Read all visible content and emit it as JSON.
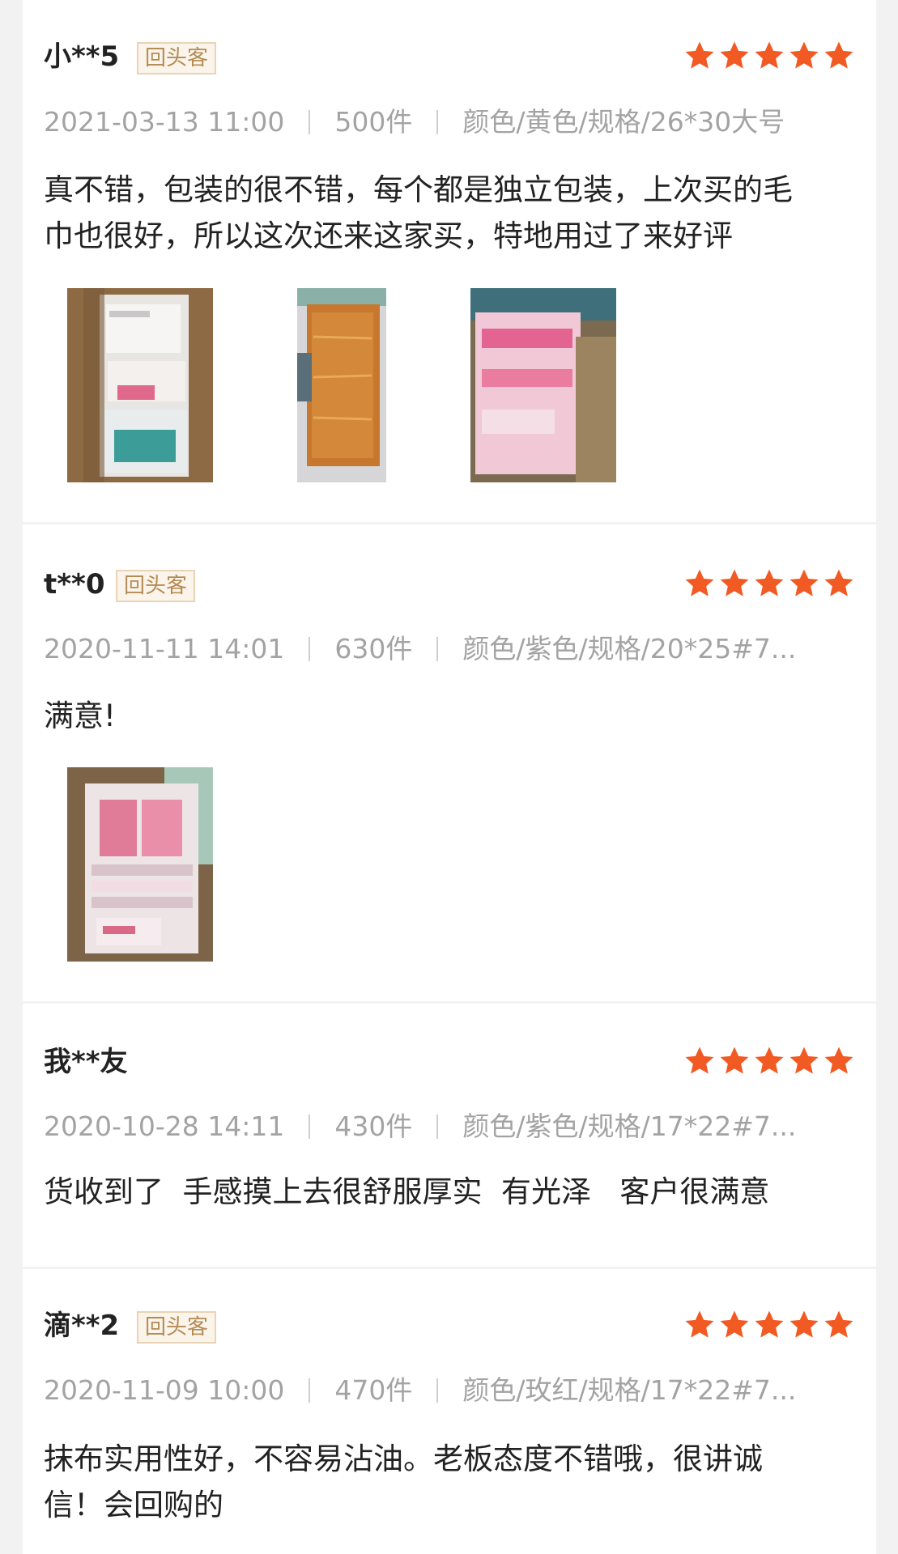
{
  "colors": {
    "page_bg": "#f2f2f2",
    "card_bg": "#ffffff",
    "star": "#f25a24",
    "badge_text": "#b48b54",
    "badge_border": "#e9d4b5",
    "meta_text": "#a3a3a3"
  },
  "reviews": [
    {
      "user": "小**5",
      "badge": "回头客",
      "rating": 5,
      "date": "2021-03-13 11:00",
      "quantity": "500件",
      "spec": "颜色/黄色/规格/26*30大号",
      "content": "真不错，包装的很不错，每个都是独立包装，上次买的毛\n巾也很好，所以这次还来这家买，特地用过了来好评",
      "photos": [
        "photo-box-of-packaged-cloths",
        "photo-gold-scouring-pad",
        "photo-pink-packages-in-box"
      ]
    },
    {
      "user": "t**0",
      "badge": "回头客",
      "rating": 5,
      "date": "2020-11-11 14:01",
      "quantity": "630件",
      "spec": "颜色/紫色/规格/20*25#7...",
      "content": "满意!",
      "photos": [
        "photo-box-of-pink-packages"
      ]
    },
    {
      "user": "我**友",
      "rating": 5,
      "date": "2020-10-28 14:11",
      "quantity": "430件",
      "spec": "颜色/紫色/规格/17*22#7...",
      "content": "货收到了  手感摸上去很舒服厚实  有光泽   客户很满意"
    },
    {
      "user": "滴**2",
      "badge": "回头客",
      "rating": 5,
      "date": "2020-11-09 10:00",
      "quantity": "470件",
      "spec": "颜色/玫红/规格/17*22#7...",
      "content": "抹布实用性好，不容易沾油。老板态度不错哦，很讲诚\n信！会回购的"
    }
  ]
}
